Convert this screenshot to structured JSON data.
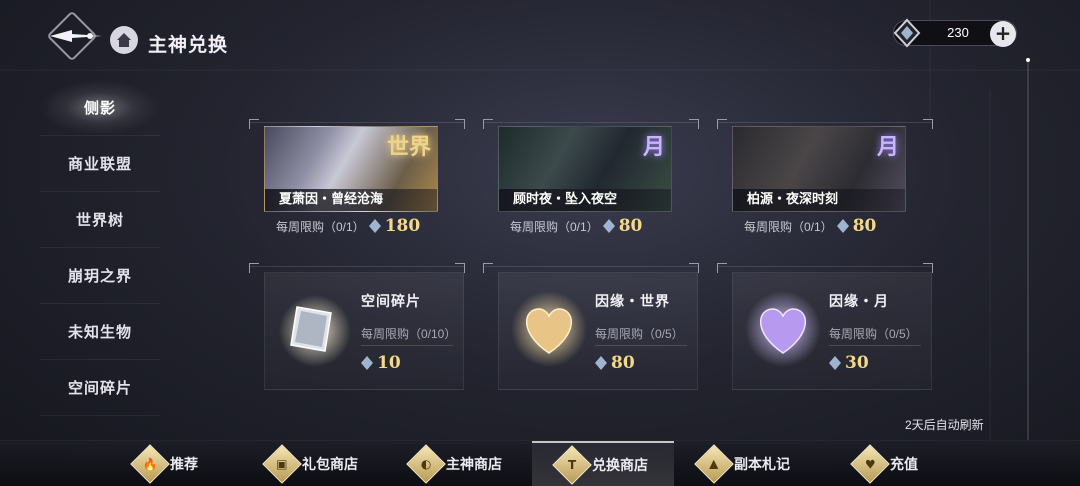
{
  "header": {
    "title": "主神兑换",
    "currency_amount": "230",
    "add_label": "+"
  },
  "sidebar": {
    "items": [
      {
        "label": "侧影",
        "active": true
      },
      {
        "label": "商业联盟",
        "active": false
      },
      {
        "label": "世界树",
        "active": false
      },
      {
        "label": "崩玥之界",
        "active": false
      },
      {
        "label": "未知生物",
        "active": false
      },
      {
        "label": "空间碎片",
        "active": false
      }
    ]
  },
  "cards": [
    {
      "name": "夏萧因・曾经沧海",
      "tag": "世界",
      "limit": "每周限购（0/1）",
      "price": "180"
    },
    {
      "name": "顾时夜・坠入夜空",
      "tag": "月",
      "limit": "每周限购（0/1）",
      "price": "80"
    },
    {
      "name": "柏源・夜深时刻",
      "tag": "月",
      "limit": "每周限购（0/1）",
      "price": "80"
    }
  ],
  "items": [
    {
      "name": "空间碎片",
      "limit": "每周限购（0/10）",
      "price": "10"
    },
    {
      "name": "因缘・世界",
      "limit": "每周限购（0/5）",
      "price": "80"
    },
    {
      "name": "因缘・月",
      "limit": "每周限购（0/5）",
      "price": "30"
    }
  ],
  "refresh_text": "2天后自动刷新",
  "bottom_nav": [
    {
      "label": "推荐",
      "icon": "flame-icon"
    },
    {
      "label": "礼包商店",
      "icon": "gift-icon"
    },
    {
      "label": "主神商店",
      "icon": "orb-icon"
    },
    {
      "label": "兑换商店",
      "icon": "exchange-icon"
    },
    {
      "label": "副本札记",
      "icon": "triangle-icon"
    },
    {
      "label": "充值",
      "icon": "heart-icon"
    }
  ],
  "colors": {
    "price_gold": "#f3d98a",
    "world_tag": "#f0d48a",
    "moon_tag": "#c9b5ff"
  }
}
